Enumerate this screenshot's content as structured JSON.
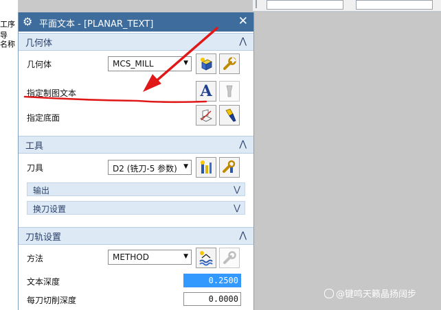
{
  "bg_left": {
    "cells": [
      "工序导",
      "名称"
    ]
  },
  "dialog": {
    "title": "平面文本 - [PLANAR_TEXT]",
    "gear_icon": "gear-icon",
    "close_glyph": "✕"
  },
  "geometry": {
    "header": "几何体",
    "collapse_glyph": "⋀",
    "geometry_label": "几何体",
    "geometry_value": "MCS_MILL",
    "drawing_text_label": "指定制图文本",
    "floor_label": "指定底面"
  },
  "tool": {
    "header": "工具",
    "collapse_glyph": "⋀",
    "tool_label": "刀具",
    "tool_value": "D2 (铣刀-5 参数)",
    "output_label": "输出",
    "tool_change_label": "换刀设置",
    "expand_glyph": "⋁"
  },
  "path": {
    "header": "刀轨设置",
    "collapse_glyph": "⋀",
    "method_label": "方法",
    "method_value": "METHOD",
    "text_depth_label": "文本深度",
    "text_depth_value": "0.2500",
    "depth_per_cut_label": "每刀切削深度",
    "depth_per_cut_value": "0.0000"
  },
  "watermark": "@键鸣天籁晶扬阔步",
  "colors": {
    "titlebar": "#3e6d9d",
    "section_bg": "#ddeaf6",
    "annotation_red": "#e01818",
    "selection": "#3399ff"
  }
}
